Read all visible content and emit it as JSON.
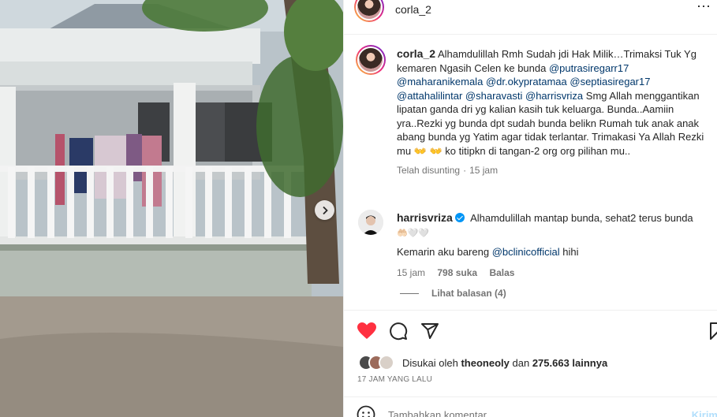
{
  "header": {
    "username": "corla_2",
    "more": "⋯"
  },
  "caption": {
    "username": "corla_2",
    "parts": {
      "t1": "Alhamdulillah Rmh Sudah jdi Hak Milik…Trimaksi Tuk Yg kemaren Ngasih Celen ke bunda ",
      "m1": "@putrasiregarr17",
      "m2": "@maharanikemala",
      "m3": "@dr.okypratamaa",
      "m4": "@septiasiregar17",
      "m5": "@attahalilintar",
      "m6": "@sharavasti",
      "m7": "@harrisvriza",
      "t2": " Smg Allah menggantikan lipatan ganda dri yg kalian kasih tuk keluarga. Bunda..Aamiin yra..Rezki yg bunda dpt sudah bunda belikn Rumah tuk anak anak abang bunda yg Yatim agar tidak terlantar. Trimakasi Ya Allah Rezki mu",
      "emoji": "👐 👐",
      "t3": " ko titipkn di tangan-2 org org pilihan mu.."
    },
    "edited": "Telah disunting",
    "time": "15 jam"
  },
  "reply": {
    "username": "harrisvriza",
    "line1": "Alhamdulillah mantap bunda, sehat2 terus bunda",
    "emojis": "🤲🏻🤍🤍",
    "line2_prefix": "Kemarin aku bareng ",
    "line2_mention": "@bclinicofficial",
    "line2_suffix": " hihi",
    "time": "15 jam",
    "likes": "798 suka",
    "reply_label": "Balas"
  },
  "view_replies": "Lihat balasan (4)",
  "likes": {
    "prefix": "Disukai oleh",
    "user": "theoneoly",
    "connector": "dan",
    "others": "275.663 lainnya"
  },
  "time_ago": "17 JAM YANG LALU",
  "comment_input": {
    "placeholder": "Tambahkan komentar...",
    "post": "Kirim"
  },
  "colors": {
    "like_red": "#ff3040",
    "mention_blue": "#00376b",
    "verified_blue": "#0095f6"
  }
}
